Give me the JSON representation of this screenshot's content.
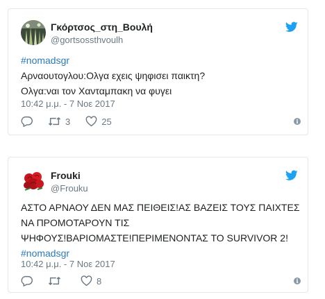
{
  "tweets": [
    {
      "name": "Γκόρτσος_στη_Βουλή",
      "handle": "@gortsossthvoulh",
      "hashtag": "#nomadsgr",
      "lines": [
        "Αρναουτογλου:Ολγα εχεις ψηφισει παικτη?",
        "Ολγα:ναι τον Χανταμπακη να φυγει"
      ],
      "time": "10:42 μ.μ. - 7 Νοε 2017",
      "retweets": "3",
      "likes": "25"
    },
    {
      "name": "Frouki",
      "handle": "@Frouku",
      "lines": [
        "ΑΣΤΟ ΑΡΝΑΟΥ ΔΕΝ ΜΑΣ ΠΕΙΘΕΙΣ!ΑΣ ΒΑΖΕΙΣ ΤΟΥΣ ΠΑΙΧΤΕΣ",
        "ΝΑ ΠΡΟΜΟΤΑΡΟΥΝ ΤΙΣ",
        "ΨΗΦΟΥΣ!ΒΑΡΙΟΜΑΣΤΕ!ΠΕΡΙΜΕΝΟΝΤΑΣ ΤΟ SURVIVOR 2!"
      ],
      "hashtag": "#nomadsgr",
      "time": "10:42 μ.μ. - 7 Νοε 2017",
      "retweets": "",
      "likes": "8"
    }
  ],
  "colors": {
    "twitter_blue": "#1da1f2",
    "link": "#2b7bb9",
    "muted": "#697882",
    "border": "#e1e8ed"
  },
  "icons": [
    "twitter-bird-icon",
    "reply-icon",
    "retweet-icon",
    "like-icon",
    "info-icon"
  ]
}
